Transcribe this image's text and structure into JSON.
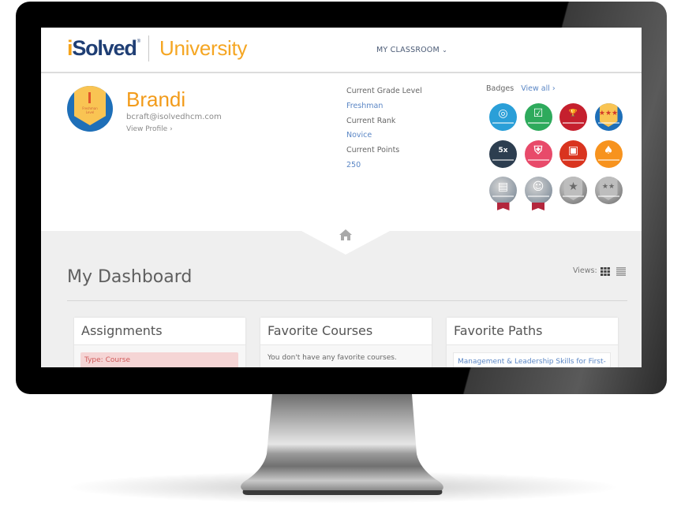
{
  "header": {
    "logo_i": "i",
    "logo_rest": "Solved",
    "logo_mark": "®",
    "product": "University",
    "nav_menu": "MY CLASSROOM",
    "nav_chevron": "⌄"
  },
  "profile": {
    "avatar_badge": "Freshman Level",
    "name": "Brandi",
    "email": "bcraft@isolvedhcm.com",
    "view_profile": "View Profile ›"
  },
  "stats": {
    "grade_label": "Current Grade Level",
    "grade_value": "Freshman",
    "rank_label": "Current Rank",
    "rank_value": "Novice",
    "points_label": "Current Points",
    "points_value": "250"
  },
  "badges": {
    "label": "Badges",
    "view_all": "View all ›",
    "items": [
      {
        "name": "target",
        "glyph": "◎",
        "color": "#2a9fd8",
        "earned": true
      },
      {
        "name": "checklist",
        "glyph": "☑",
        "color": "#2eaa5c",
        "earned": true
      },
      {
        "name": "trophy",
        "glyph": "🏆",
        "color": "#c5202e",
        "earned": true
      },
      {
        "name": "three-stars-shield",
        "glyph": "★★★",
        "color": "#1e6fb8",
        "earned": true
      },
      {
        "name": "5x",
        "glyph": "5x",
        "color": "#2d3e50",
        "earned": true
      },
      {
        "name": "shield",
        "glyph": "⛨",
        "color": "#e84a6a",
        "earned": true
      },
      {
        "name": "screen",
        "glyph": "▣",
        "color": "#d9341f",
        "earned": true
      },
      {
        "name": "spade-1",
        "glyph": "♠",
        "color": "#f7931e",
        "earned": true
      },
      {
        "name": "document-medal",
        "glyph": "▤",
        "color": "#8f9aa5",
        "earned": false
      },
      {
        "name": "people-medal",
        "glyph": "☺",
        "color": "#8f9aa5",
        "earned": false
      },
      {
        "name": "one-star-shield",
        "glyph": "★",
        "color": "#8a8a8a",
        "earned": false
      },
      {
        "name": "two-star-shield",
        "glyph": "★★",
        "color": "#8a8a8a",
        "earned": false
      }
    ]
  },
  "dashboard": {
    "title": "My Dashboard",
    "views_label": "Views:",
    "cards": [
      {
        "title": "Assignments",
        "item": "Type: Course"
      },
      {
        "title": "Favorite Courses",
        "empty": "You don't have any favorite courses."
      },
      {
        "title": "Favorite Paths",
        "item": "Management & Leadership Skills for First-"
      }
    ]
  },
  "colors": {
    "brand_navy": "#1f3e74",
    "brand_orange": "#f5a31a",
    "link_blue": "#5a86c5"
  }
}
